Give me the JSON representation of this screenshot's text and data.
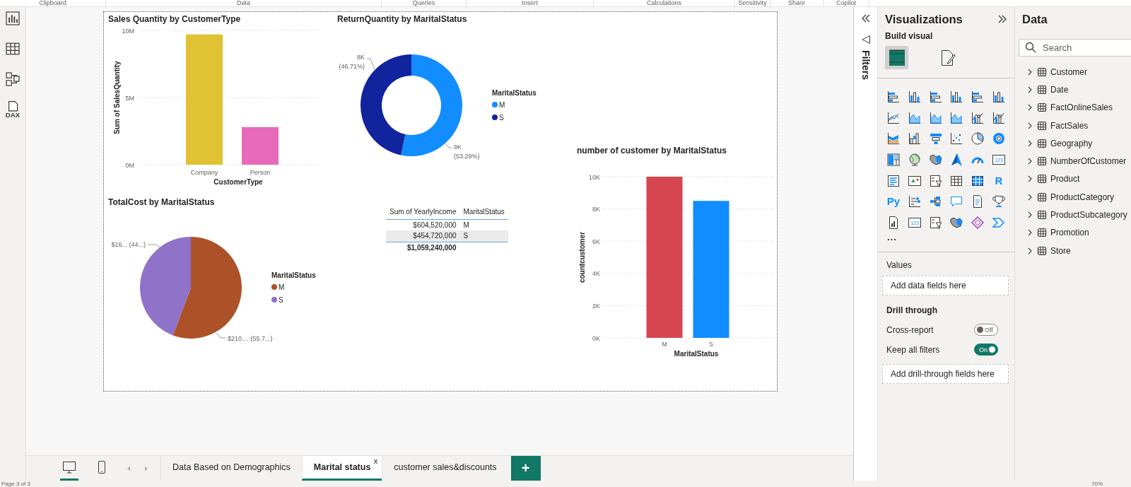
{
  "ribbon_groups": [
    "Clipboard",
    "Data",
    "Queries",
    "Insert",
    "Calculations",
    "Sensitivity",
    "Share",
    "Copilot"
  ],
  "left_rail": [
    {
      "kind": "report"
    },
    {
      "kind": "table"
    },
    {
      "kind": "model"
    },
    {
      "kind": "dax",
      "label": "DAX"
    }
  ],
  "visuals": [
    {
      "title": "Sales Quantity by CustomerType",
      "chart_data": {
        "type": "bar",
        "xlabel": "CustomerType",
        "ylabel": "Sum of SalesQuantity",
        "categories": [
          "Company",
          "Person"
        ],
        "colors": [
          "#e0c232",
          "#e66ab9"
        ],
        "grid": true,
        "series": [
          {
            "values": [
              9700000,
              2800000
            ]
          }
        ],
        "ylim": [
          0,
          10000000
        ],
        "yticks": [
          {
            "value": 0,
            "label": "0M"
          },
          {
            "value": 5000000,
            "label": "5M"
          },
          {
            "value": 10000000,
            "label": "10M"
          }
        ]
      }
    },
    {
      "title": "ReturnQuantity by MaritalStatus",
      "slice_labels": [
        {
          "value": "9K",
          "share": "(53.29%)"
        },
        {
          "value": "8K",
          "share": "(46.71%)"
        }
      ],
      "chart_data": {
        "type": "donut",
        "categories": [
          "M",
          "S"
        ],
        "colors": [
          "#118dff",
          "#12239e"
        ],
        "legend": {
          "title": "MaritalStatus"
        },
        "series": [
          {
            "values": [
              53.29,
              46.71
            ]
          }
        ]
      }
    },
    {
      "title": "TotalCost by MaritalStatus",
      "slice_labels": [
        {
          "value": "$210....",
          "share": "(55.7...)"
        },
        {
          "value": "$16...",
          "share": "(44...)"
        }
      ],
      "chart_data": {
        "type": "pie",
        "categories": [
          "M",
          "S"
        ],
        "colors": [
          "#ad5129",
          "#8f73c9"
        ],
        "legend": {
          "title": "MaritalStatus"
        },
        "series": [
          {
            "values": [
              55.7,
              44.3
            ]
          }
        ]
      }
    },
    {
      "kind": "table",
      "columns": [
        "Sum of YearlyIncome",
        "MaritalStatus"
      ],
      "rows": [
        [
          "$604,520,000",
          "M"
        ],
        [
          "$454,720,000",
          "S"
        ]
      ],
      "total": "$1,059,240,000"
    },
    {
      "title": "number of customer by MaritalStatus",
      "chart_data": {
        "type": "bar",
        "xlabel": "MaritalStatus",
        "ylabel": "countcustomer",
        "categories": [
          "M",
          "S"
        ],
        "colors": [
          "#d64550",
          "#118dff"
        ],
        "grid": true,
        "series": [
          {
            "values": [
              10000,
              8500
            ]
          }
        ],
        "ylim": [
          0,
          10000
        ],
        "yticks": [
          {
            "value": 0,
            "label": "0K"
          },
          {
            "value": 2000,
            "label": "2K"
          },
          {
            "value": 4000,
            "label": "4K"
          },
          {
            "value": 6000,
            "label": "6K"
          },
          {
            "value": 8000,
            "label": "8K"
          },
          {
            "value": 10000,
            "label": "10K"
          }
        ]
      }
    }
  ],
  "filters_pane": {
    "title": "Filters"
  },
  "visualizations_pane": {
    "title": "Visualizations",
    "build_label": "Build visual",
    "build_tabs": [
      {
        "kind": "fields",
        "selected": true
      },
      {
        "kind": "format",
        "selected": false
      }
    ],
    "viz_icons": [
      {
        "kind": "hbar"
      },
      {
        "kind": "vbar"
      },
      {
        "kind": "hbar"
      },
      {
        "kind": "vbar"
      },
      {
        "kind": "hbar"
      },
      {
        "kind": "vbar"
      },
      {
        "kind": "line"
      },
      {
        "kind": "area"
      },
      {
        "kind": "area"
      },
      {
        "kind": "area"
      },
      {
        "kind": "combo"
      },
      {
        "kind": "combo"
      },
      {
        "kind": "ribbon"
      },
      {
        "kind": "waterfall"
      },
      {
        "kind": "funnel"
      },
      {
        "kind": "scatter"
      },
      {
        "kind": "pie"
      },
      {
        "kind": "donut"
      },
      {
        "kind": "treemap"
      },
      {
        "kind": "globe"
      },
      {
        "kind": "map"
      },
      {
        "kind": "arrow"
      },
      {
        "kind": "gauge"
      },
      {
        "kind": "card",
        "label": "123"
      },
      {
        "kind": "list"
      },
      {
        "kind": "kpi"
      },
      {
        "kind": "slicer"
      },
      {
        "kind": "table"
      },
      {
        "kind": "matrix"
      },
      {
        "kind": "letter",
        "label": "R"
      },
      {
        "kind": "letter",
        "label": "Py"
      },
      {
        "kind": "influencers"
      },
      {
        "kind": "tree"
      },
      {
        "kind": "bubble"
      },
      {
        "kind": "doc"
      },
      {
        "kind": "trophy"
      },
      {
        "kind": "paginated"
      },
      {
        "kind": "card",
        "label": "123"
      },
      {
        "kind": "slicer"
      },
      {
        "kind": "map"
      },
      {
        "kind": "diamond"
      },
      {
        "kind": "chevron"
      }
    ],
    "more": "...",
    "values_label": "Values",
    "values_placeholder": "Add data fields here",
    "drill_title": "Drill through",
    "toggles": [
      {
        "label": "Cross-report",
        "on": false,
        "text": "Off"
      },
      {
        "label": "Keep all filters",
        "on": true,
        "text": "On"
      }
    ],
    "drill_placeholder": "Add drill-through fields here"
  },
  "data_pane": {
    "title": "Data",
    "search": {
      "placeholder": "Search"
    },
    "tables": [
      {
        "name": "Customer",
        "expanded": false
      },
      {
        "name": "Date",
        "expanded": false
      },
      {
        "name": "FactOnlineSales",
        "expanded": false
      },
      {
        "name": "FactSales",
        "expanded": false
      },
      {
        "name": "Geography",
        "expanded": false
      },
      {
        "name": "NumberOfCustomer",
        "expanded": false
      },
      {
        "name": "Product",
        "expanded": false
      },
      {
        "name": "ProductCategory",
        "expanded": false
      },
      {
        "name": "ProductSubcategory",
        "expanded": false
      },
      {
        "name": "Promotion",
        "expanded": false
      },
      {
        "name": "Store",
        "expanded": false
      }
    ]
  },
  "page_tabs": {
    "views": [
      {
        "kind": "desktop",
        "selected": true
      },
      {
        "kind": "phone",
        "selected": false
      }
    ],
    "tabs": [
      {
        "label": "Data Based on Demographics",
        "selected": false
      },
      {
        "label": "Marital status",
        "selected": true,
        "close": "x"
      },
      {
        "label": "customer sales&discounts",
        "selected": false
      }
    ],
    "add": "+"
  },
  "status_bar": {
    "page": "Page 3 of 3",
    "zoom": "70%"
  }
}
